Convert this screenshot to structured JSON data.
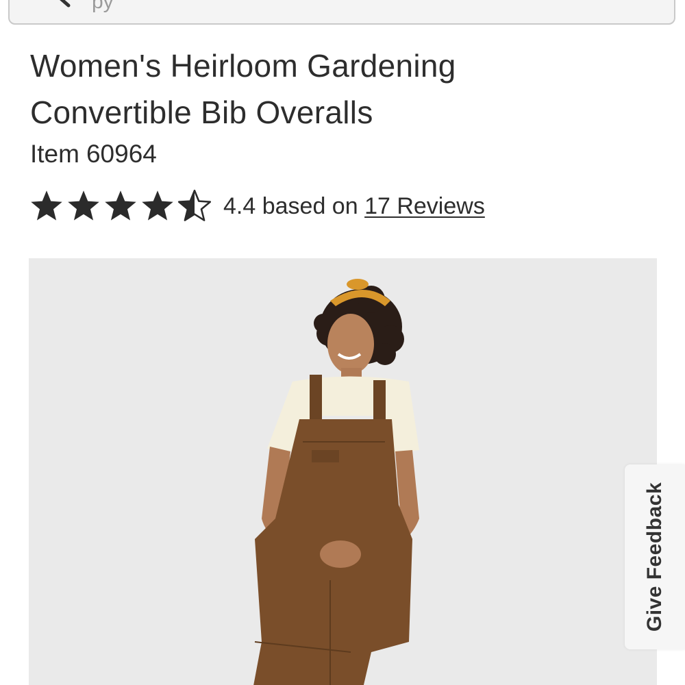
{
  "search": {
    "placeholder_fragment": "py",
    "icon": "search-icon"
  },
  "product": {
    "title_line1": "Women's Heirloom Gardening",
    "title_line2": "Convertible Bib Overalls",
    "item_prefix": "Item",
    "item_number": "60964",
    "image_alt": "Model wearing brown bib overalls with cream tee and mustard headband"
  },
  "rating": {
    "value": 4.4,
    "max": 5,
    "text_prefix": "4.4 based on",
    "reviews_link": "17 Reviews",
    "star_color": "#2b2b2b"
  },
  "feedback": {
    "label": "Give Feedback"
  },
  "colors": {
    "text": "#2d2d2d",
    "image_background": "#eaeaea",
    "overalls": "#7a4e2a",
    "headband": "#d9972b",
    "tshirt": "#f4efdc"
  }
}
